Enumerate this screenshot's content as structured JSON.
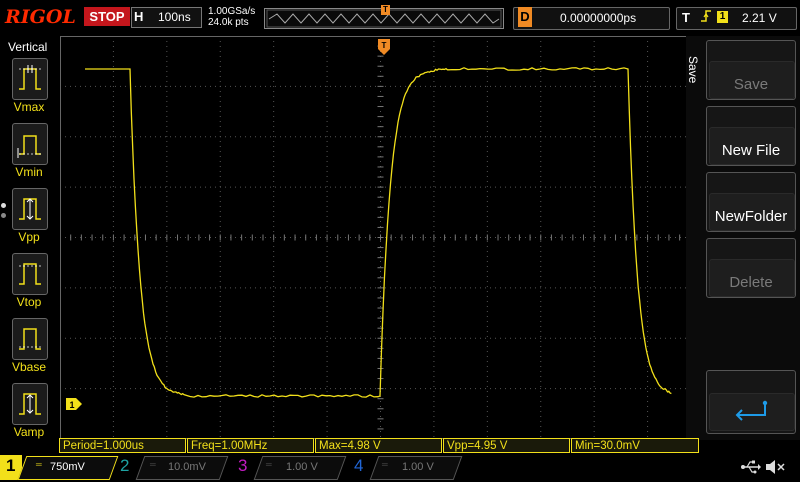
{
  "header": {
    "logo": "RIGOL",
    "run_status": "STOP",
    "timebase_label": "H",
    "timebase": "100ns",
    "sample_rate": "1.00GSa/s",
    "memory_depth": "24.0k pts",
    "trigger_position_marker": "T",
    "delay_label": "D",
    "delay_value": "0.00000000ps",
    "trigger_label": "T",
    "trigger_source": "1",
    "trigger_level": "2.21 V"
  },
  "left_panel": {
    "title": "Vertical",
    "items": [
      {
        "label": "Vmax"
      },
      {
        "label": "Vmin"
      },
      {
        "label": "Vpp"
      },
      {
        "label": "Vtop"
      },
      {
        "label": "Vbase"
      },
      {
        "label": "Vamp"
      }
    ]
  },
  "right_menu": {
    "title": "Save",
    "items": [
      {
        "label": "Save",
        "enabled": false
      },
      {
        "label": "New File",
        "enabled": true
      },
      {
        "label": "NewFolder",
        "enabled": true
      },
      {
        "label": "Delete",
        "enabled": false
      }
    ]
  },
  "measurements": [
    {
      "text": "Period=1.000us"
    },
    {
      "text": "Freq=1.00MHz"
    },
    {
      "text": "Max=4.98 V"
    },
    {
      "text": "Vpp=4.95 V"
    },
    {
      "text": "Min=30.0mV"
    }
  ],
  "channels": [
    {
      "num": "1",
      "scale": "750mV",
      "color": "#f2e01a",
      "active": true
    },
    {
      "num": "2",
      "scale": "10.0mV",
      "color": "#1ea3a3",
      "active": false
    },
    {
      "num": "3",
      "scale": "1.00 V",
      "color": "#c21cc2",
      "active": false
    },
    {
      "num": "4",
      "scale": "1.00 V",
      "color": "#2166d6",
      "active": false
    }
  ],
  "markers": {
    "channel_ground": "1",
    "trigger_top": "T"
  },
  "colors": {
    "trace": "#f2e01a",
    "trigger": "#f08a24",
    "grid": "#3a3a3a"
  }
}
